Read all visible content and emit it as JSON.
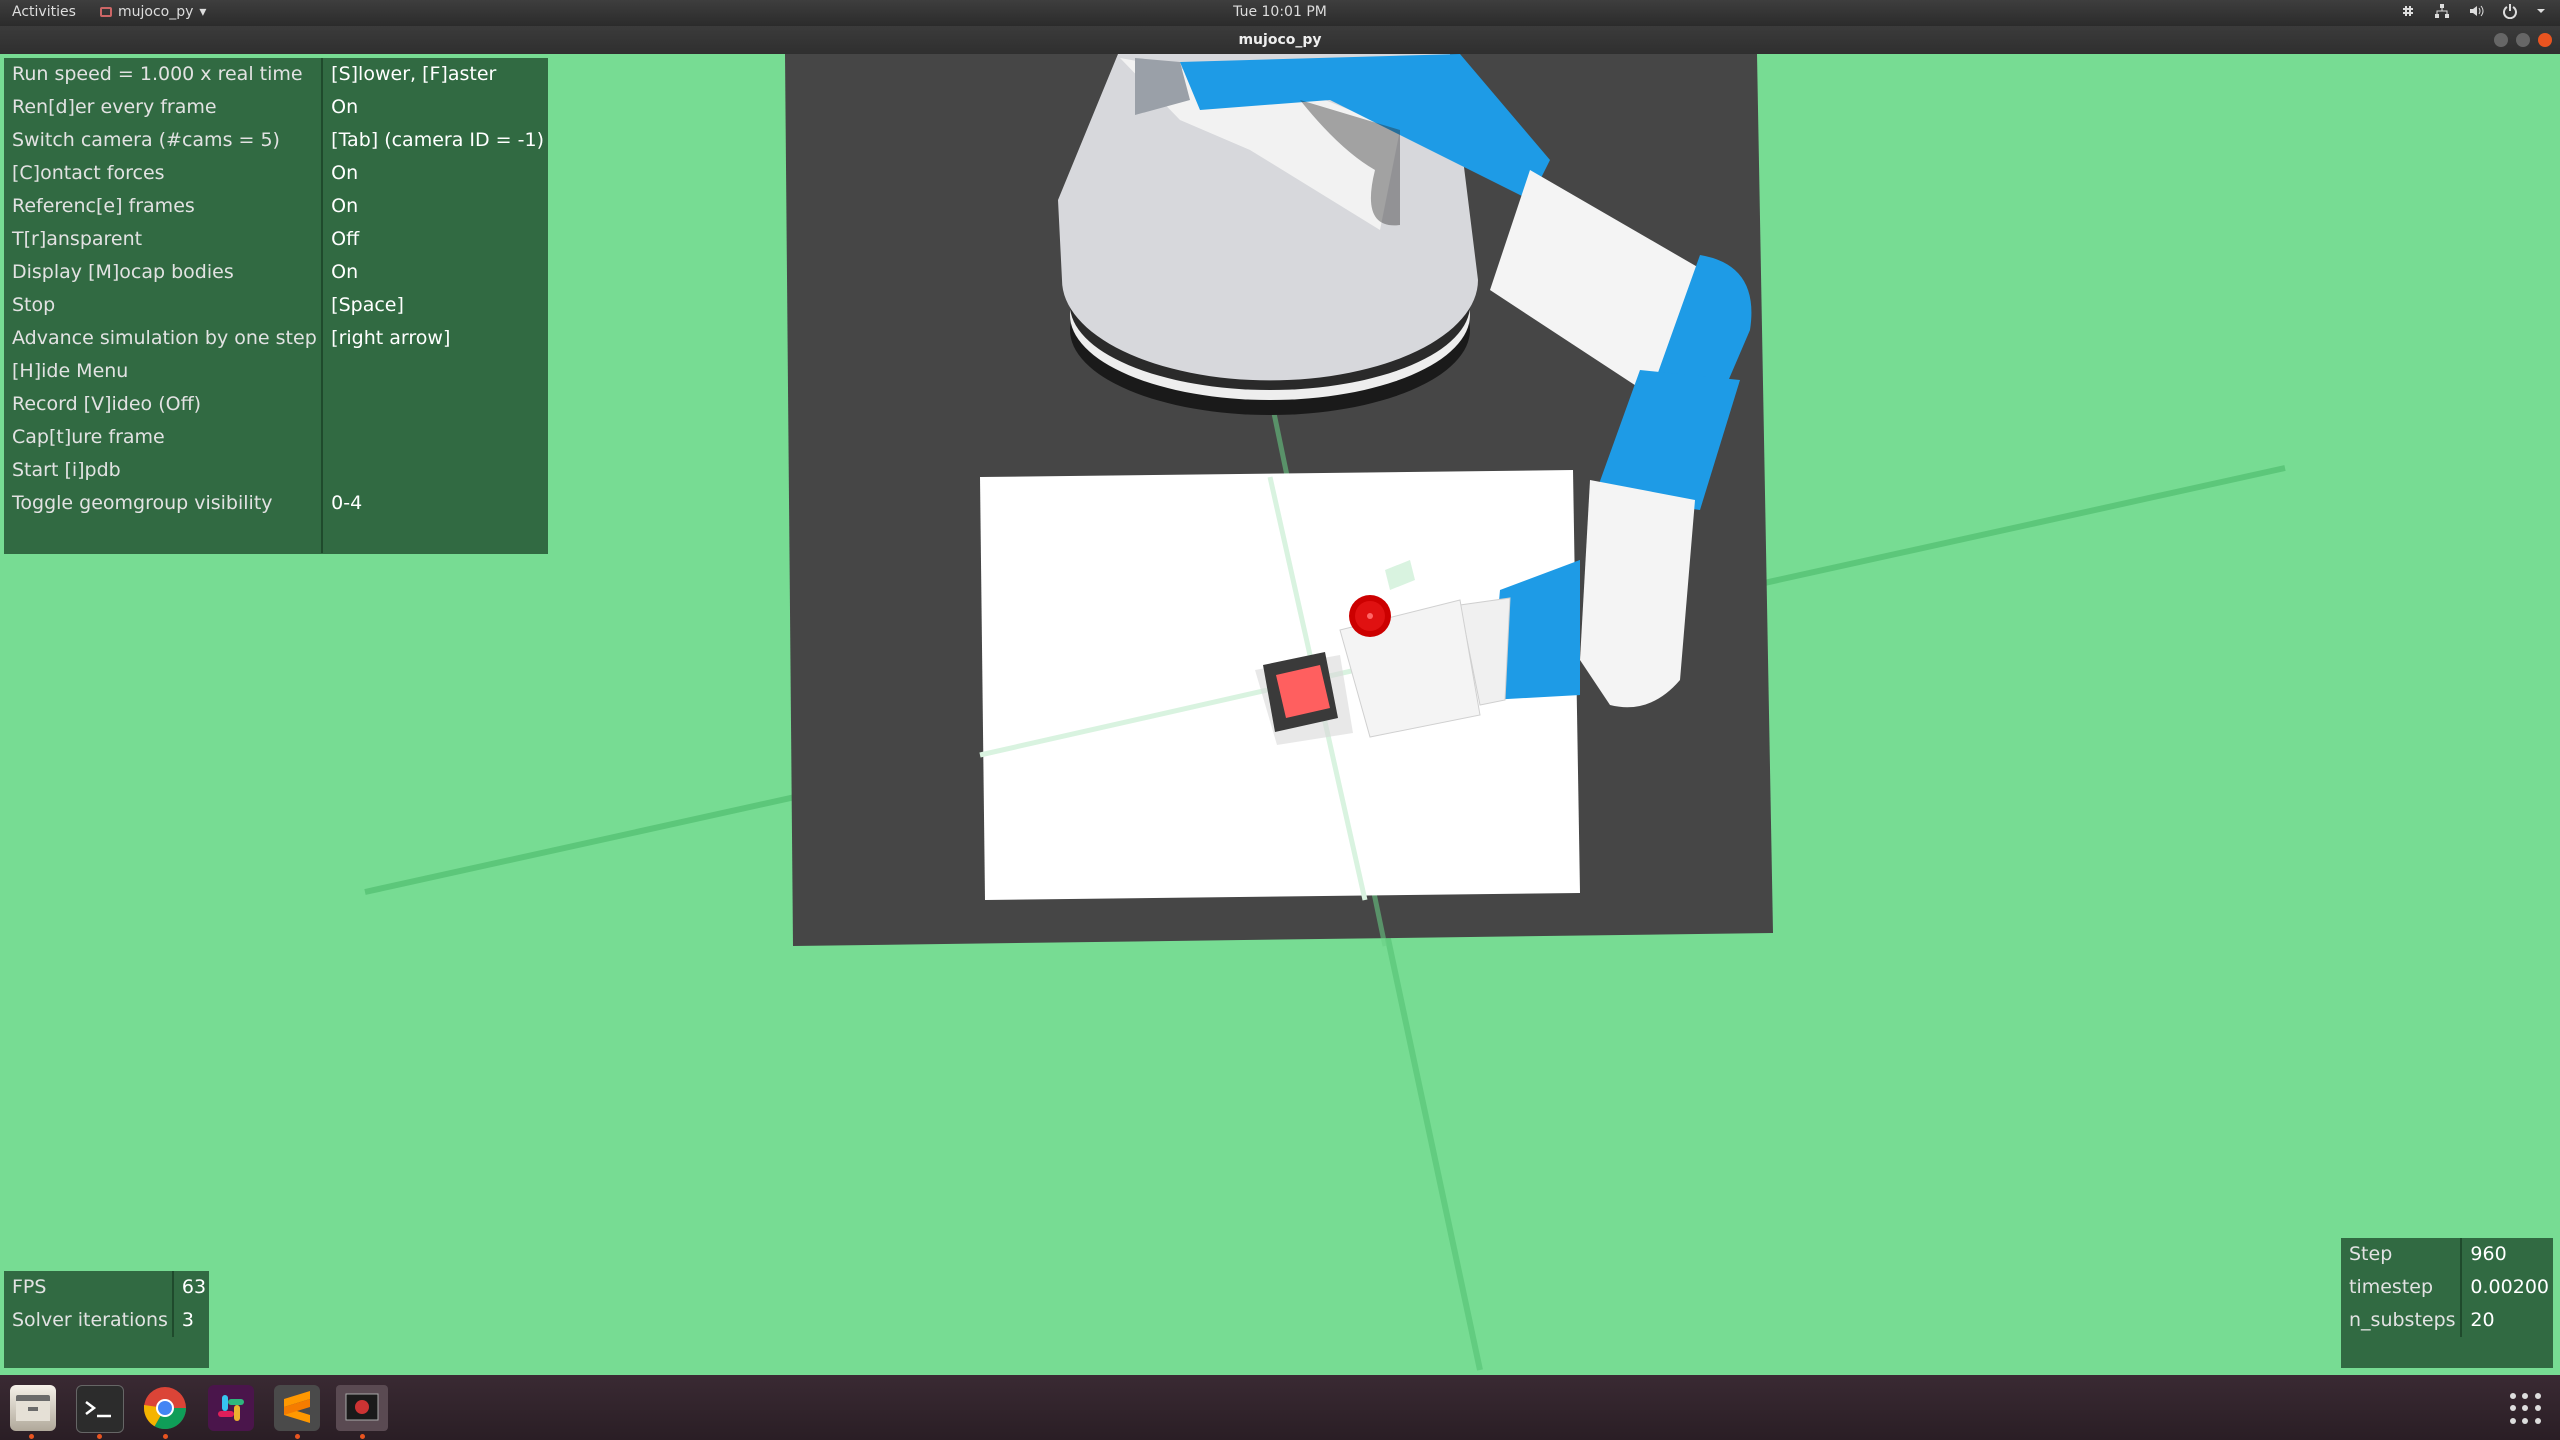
{
  "topbar": {
    "activities": "Activities",
    "app_name": "mujoco_py",
    "app_chevron": "▾",
    "clock": "Tue 10:01 PM",
    "tray_icons": [
      "slack-tray-icon",
      "network-icon",
      "volume-icon",
      "power-icon",
      "chevron-down-icon"
    ]
  },
  "window": {
    "title": "mujoco_py"
  },
  "menu": {
    "rows": [
      {
        "label": "Run speed = 1.000 x real time",
        "value": "[S]lower, [F]aster"
      },
      {
        "label": "Ren[d]er every frame",
        "value": "On"
      },
      {
        "label": "Switch camera (#cams = 5)",
        "value": "[Tab] (camera ID = -1)"
      },
      {
        "label": "[C]ontact forces",
        "value": "On"
      },
      {
        "label": "Referenc[e] frames",
        "value": "On"
      },
      {
        "label": "T[r]ansparent",
        "value": "Off"
      },
      {
        "label": "Display [M]ocap bodies",
        "value": "On"
      },
      {
        "label": "Stop",
        "value": "[Space]"
      },
      {
        "label": "Advance simulation by one step",
        "value": "[right arrow]"
      },
      {
        "label": "[H]ide Menu",
        "value": ""
      },
      {
        "label": "Record [V]ideo (Off)",
        "value": ""
      },
      {
        "label": "Cap[t]ure frame",
        "value": ""
      },
      {
        "label": "Start [i]pdb",
        "value": ""
      },
      {
        "label": "Toggle geomgroup visibility",
        "value": "0-4"
      }
    ]
  },
  "fps": {
    "rows": [
      {
        "label": "FPS",
        "value": "63"
      },
      {
        "label": "Solver iterations",
        "value": "3"
      }
    ]
  },
  "step": {
    "rows": [
      {
        "label": "Step",
        "value": "960"
      },
      {
        "label": "timestep",
        "value": "0.00200"
      },
      {
        "label": "n_substeps",
        "value": "20"
      }
    ]
  },
  "dock": {
    "apps": [
      "files-icon",
      "terminal-icon",
      "chrome-icon",
      "slack-icon",
      "sublime-text-icon",
      "mujoco-window-icon"
    ]
  },
  "colors": {
    "floor": "#77dc93",
    "table": "#464646",
    "arm_blue": "#1e9be6",
    "target": "#dd1111",
    "cube": "#ff5f5f"
  }
}
